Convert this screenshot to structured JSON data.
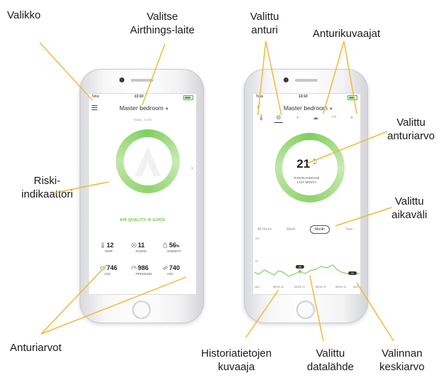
{
  "annotations": {
    "menu": "Valikko",
    "choose_device_1": "Valitse",
    "choose_device_2": "Airthings-laite",
    "risk_1": "Riski-",
    "risk_2": "indikaattori",
    "sensor_values": "Anturiarvot",
    "selected_sensor_1": "Valittu",
    "selected_sensor_2": "anturi",
    "sensor_graphs": "Anturikuvaajat",
    "selected_value_1": "Valittu",
    "selected_value_2": "anturiarvo",
    "selected_range_1": "Valittu",
    "selected_range_2": "aikaväli",
    "history_1": "Historiatietojen",
    "history_2": "kuvaaja",
    "datasource_1": "Valittu",
    "datasource_2": "datalähde",
    "average_1": "Valinnan",
    "average_2": "keskiarvo"
  },
  "left_phone": {
    "carrier": "Telia",
    "time": "13:10",
    "room": "Master bedroom",
    "today": "Today, 13:00",
    "status": "AIR QUALITY IS GOOD",
    "sensors": [
      {
        "value": "12",
        "unit": "",
        "name": "TEMP",
        "icon": "thermometer-icon"
      },
      {
        "value": "11",
        "unit": "",
        "name": "RADON",
        "icon": "radon-icon"
      },
      {
        "value": "56",
        "unit": "%",
        "name": "HUMIDITY",
        "icon": "humidity-icon"
      },
      {
        "value": "746",
        "unit": "",
        "name": "CO2",
        "icon": "cloud-icon"
      },
      {
        "value": "986",
        "unit": "",
        "name": "PRESSURE",
        "icon": "gauge-icon"
      },
      {
        "value": "740",
        "unit": "",
        "name": "VOC",
        "icon": "voc-icon"
      }
    ]
  },
  "right_phone": {
    "carrier": "Telia",
    "time": "13:10",
    "room": "Master bedroom",
    "value": "21",
    "unit_top": "Bq",
    "unit_bottom": "m³",
    "caption_1": "RADON AVERAGE",
    "caption_2": "LAST MONTH",
    "periods": [
      "48 Hours",
      "Week",
      "Month",
      "Year"
    ],
    "selected_period": "Month",
    "y_top": "100",
    "y_mid": "50",
    "point_label": "35",
    "avg_label": "21",
    "x_labels": [
      "JULY",
      "WEEK 30",
      "WEEK 31",
      "WEEK 32",
      "WEEK 33",
      "AUG"
    ],
    "colors": {
      "accent": "#6cc24a",
      "ring_light": "#c9eab4"
    }
  }
}
